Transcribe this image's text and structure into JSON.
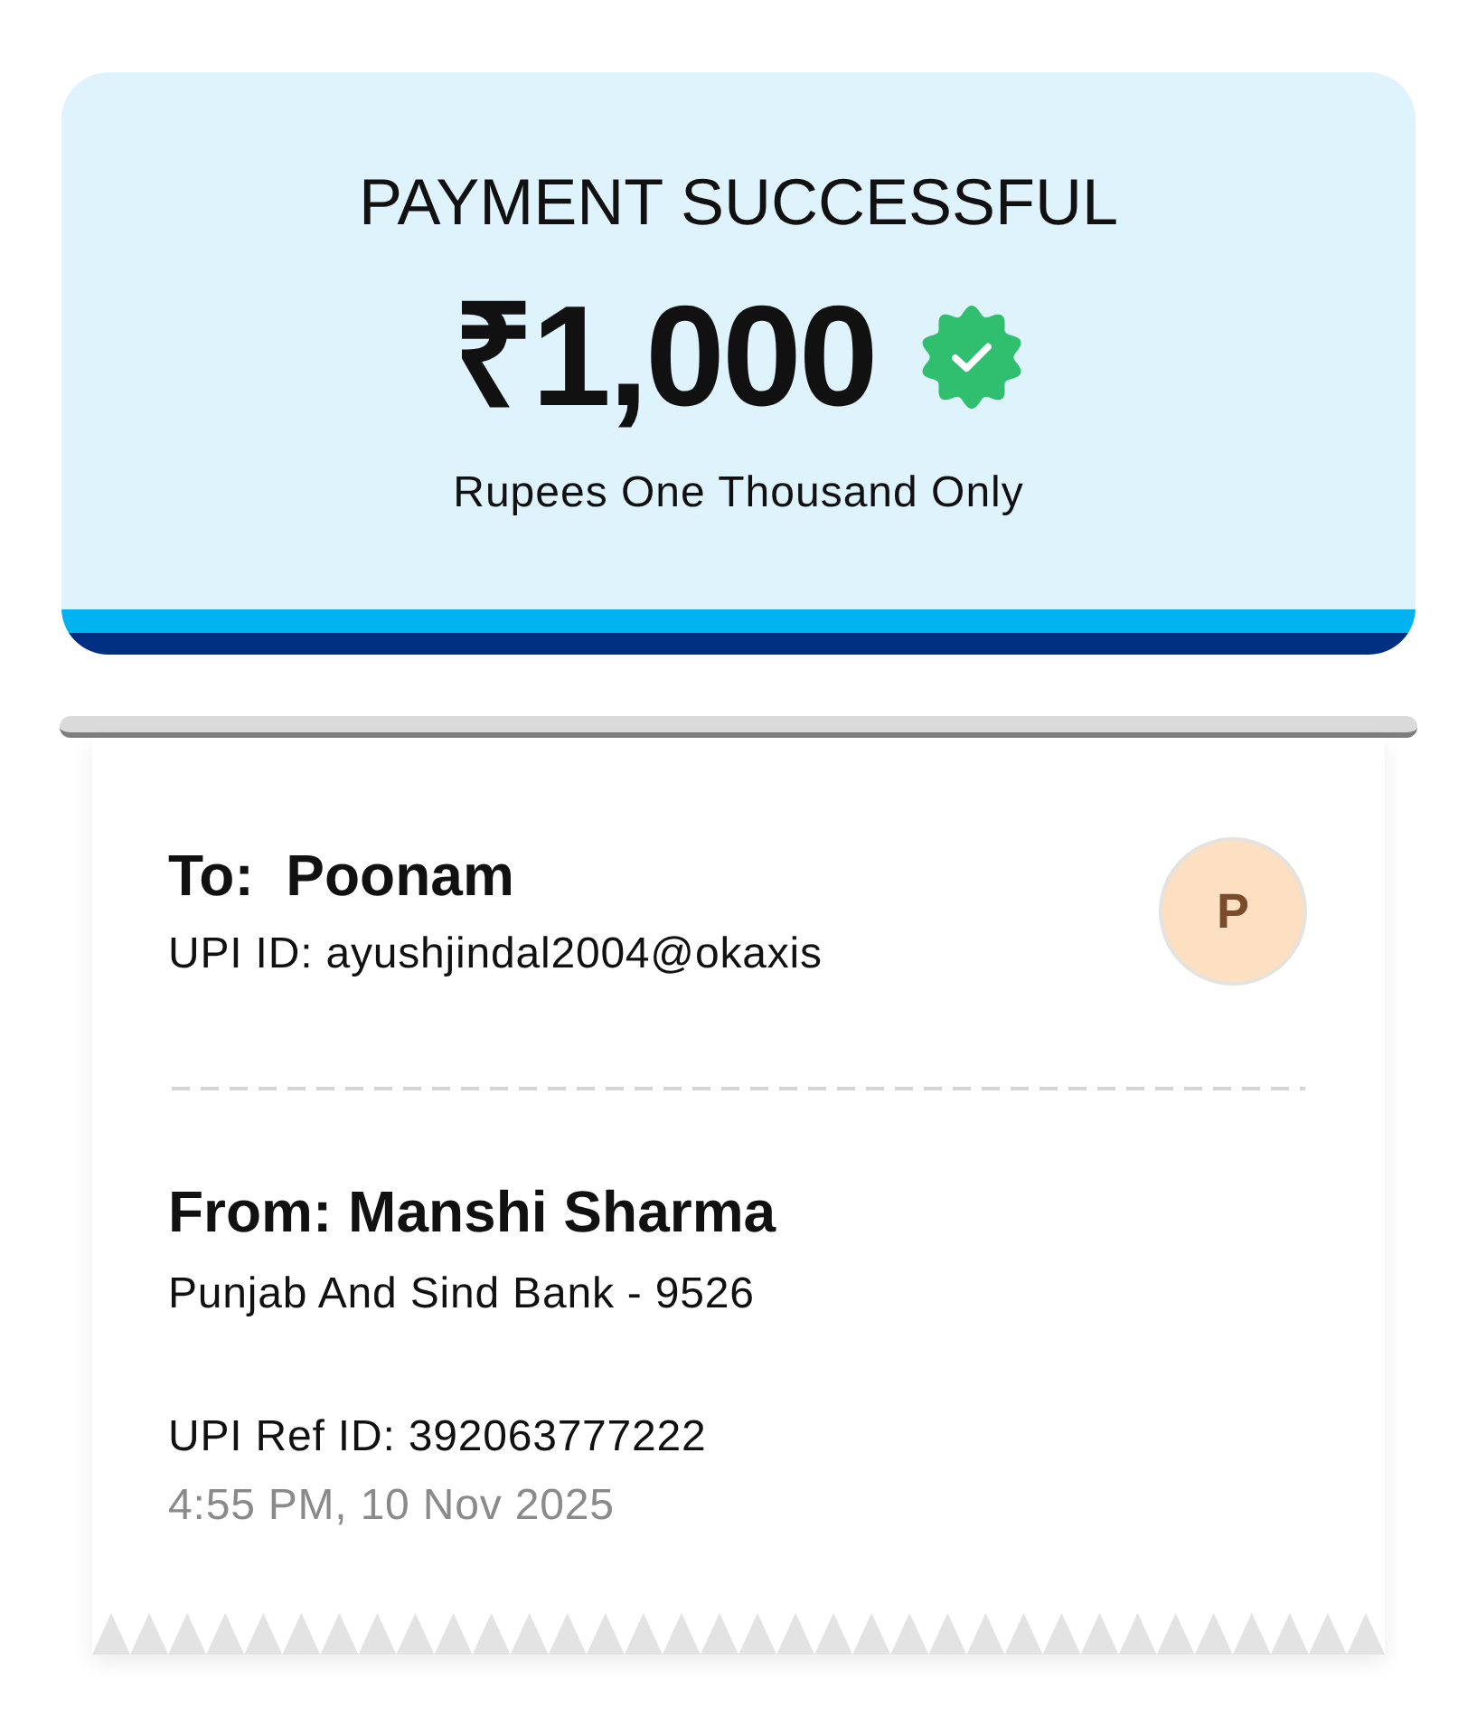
{
  "header": {
    "title": "PAYMENT SUCCESSFUL",
    "amount": "₹1,000",
    "verified": true,
    "amount_in_words": "Rupees One Thousand Only"
  },
  "recipient": {
    "name": "To:  Poonam",
    "upi_id": "UPI ID: ayushjindal2004@okaxis",
    "avatar_initial": "P"
  },
  "sender": {
    "name": "From: Manshi Sharma",
    "bank": "Punjab And Sind Bank - 9526"
  },
  "reference": "UPI Ref ID: 392063777222",
  "timestamp": "4:55 PM, 10 Nov 2025"
}
